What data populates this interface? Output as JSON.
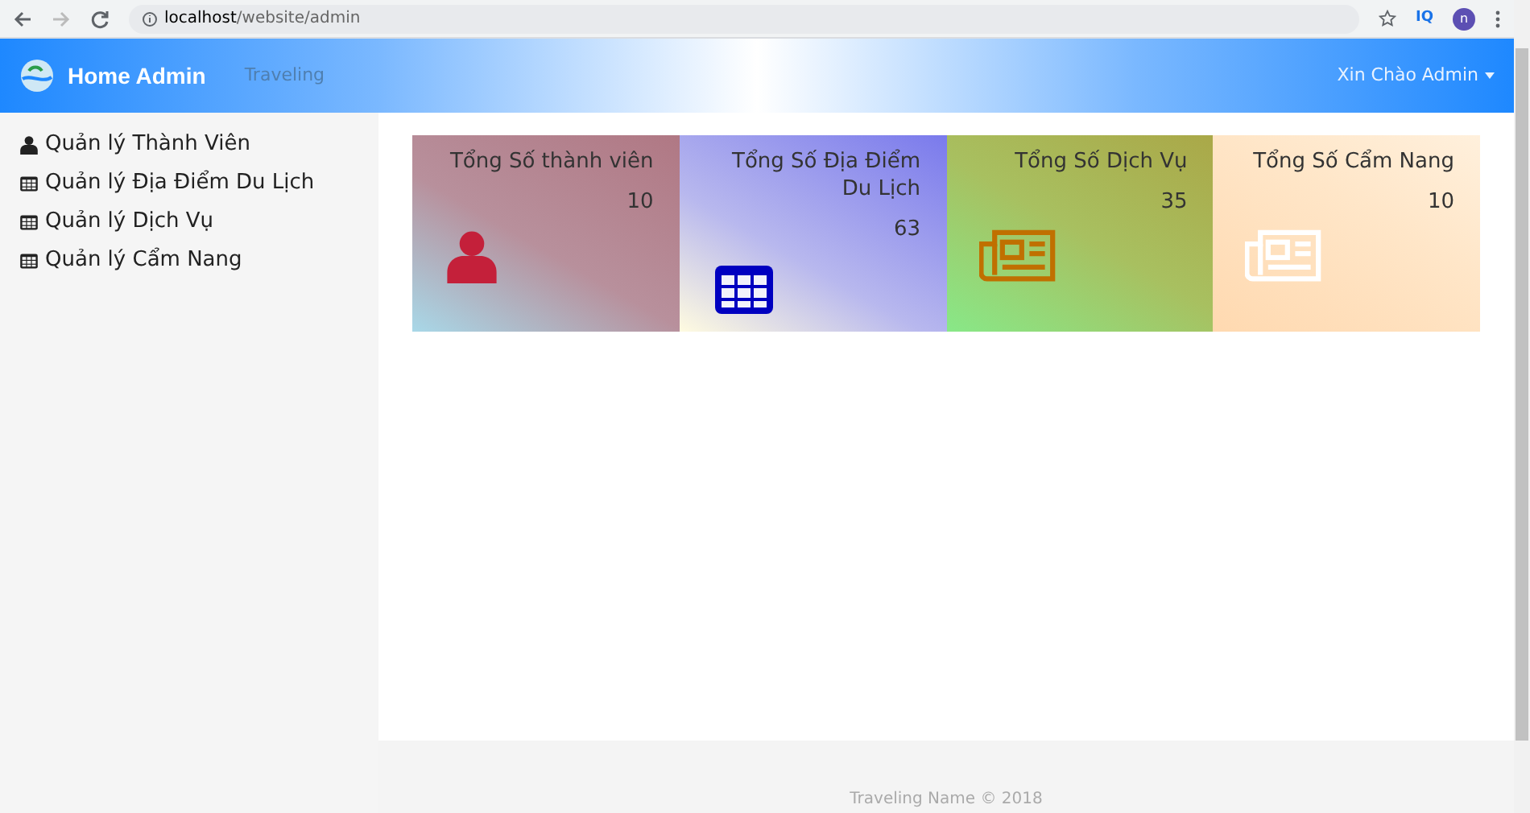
{
  "browser": {
    "url_host": "localhost",
    "url_path": "/website/admin",
    "extension": "IQ",
    "profile": "n"
  },
  "navbar": {
    "brand": "Home Admin",
    "link": "Traveling",
    "user_menu": "Xin Chào Admin"
  },
  "sidebar": {
    "items": [
      {
        "label": "Quản lý Thành Viên",
        "kind": "person"
      },
      {
        "label": "Quản lý Địa Điểm Du Lịch",
        "kind": "table"
      },
      {
        "label": "Quản lý Dịch Vụ",
        "kind": "table"
      },
      {
        "label": "Quản lý Cẩm Nang",
        "kind": "table"
      }
    ]
  },
  "cards": [
    {
      "title": "Tổng Số thành viên",
      "count": "10",
      "kind": "person"
    },
    {
      "title": "Tổng Số Địa Điểm Du Lịch",
      "count": "63",
      "kind": "table"
    },
    {
      "title": "Tổng Số Dịch Vụ",
      "count": "35",
      "kind": "newspaper"
    },
    {
      "title": "Tổng Số Cẩm Nang",
      "count": "10",
      "kind": "newspaper"
    }
  ],
  "footer": "Traveling Name © 2018"
}
